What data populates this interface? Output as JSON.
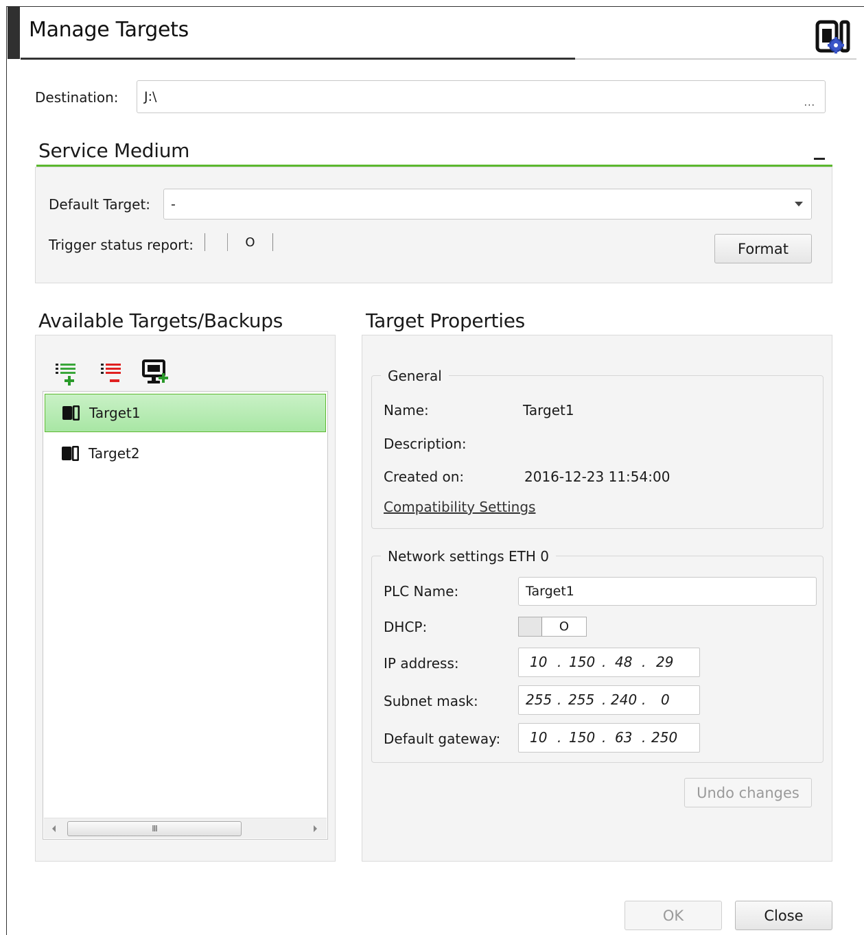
{
  "window": {
    "title": "Manage Targets",
    "app_icon": "target-gear-icon"
  },
  "destination": {
    "label": "Destination:",
    "value": "J:\\",
    "browse_label": "..."
  },
  "service_medium": {
    "title": "Service Medium",
    "collapse_icon": "collapse-icon",
    "default_target_label": "Default Target:",
    "default_target_value": "-",
    "trigger_label": "Trigger status report:",
    "trigger_value": "O",
    "format_label": "Format"
  },
  "targets": {
    "title": "Available Targets/Backups",
    "toolbar": [
      "add-target-icon",
      "remove-target-icon",
      "add-device-icon"
    ],
    "items": [
      {
        "label": "Target1",
        "selected": true
      },
      {
        "label": "Target2",
        "selected": false
      }
    ],
    "scroll_thumb": "III"
  },
  "properties": {
    "title": "Target Properties",
    "general": {
      "title": "General",
      "name_label": "Name:",
      "name_value": "Target1",
      "description_label": "Description:",
      "description_value": "",
      "created_label": "Created on:",
      "created_value": "2016-12-23 11:54:00",
      "compat_link": "Compatibility Settings"
    },
    "network": {
      "title": "Network settings ETH 0",
      "plc_label": "PLC Name:",
      "plc_value": "Target1",
      "dhcp_label": "DHCP:",
      "dhcp_value": "O",
      "ip_label": "IP address:",
      "ip": [
        "10",
        "150",
        "48",
        "29"
      ],
      "subnet_label": "Subnet mask:",
      "subnet": [
        "255",
        "255",
        "240",
        "0"
      ],
      "gateway_label": "Default gateway:",
      "gateway": [
        "10",
        "150",
        "63",
        "250"
      ],
      "dot": "."
    },
    "undo_label": "Undo changes"
  },
  "footer": {
    "ok_label": "OK",
    "close_label": "Close"
  },
  "colors": {
    "accent_green": "#5cb82f",
    "selection_fill": "#b8ebb4",
    "title_bar": "#303030"
  }
}
